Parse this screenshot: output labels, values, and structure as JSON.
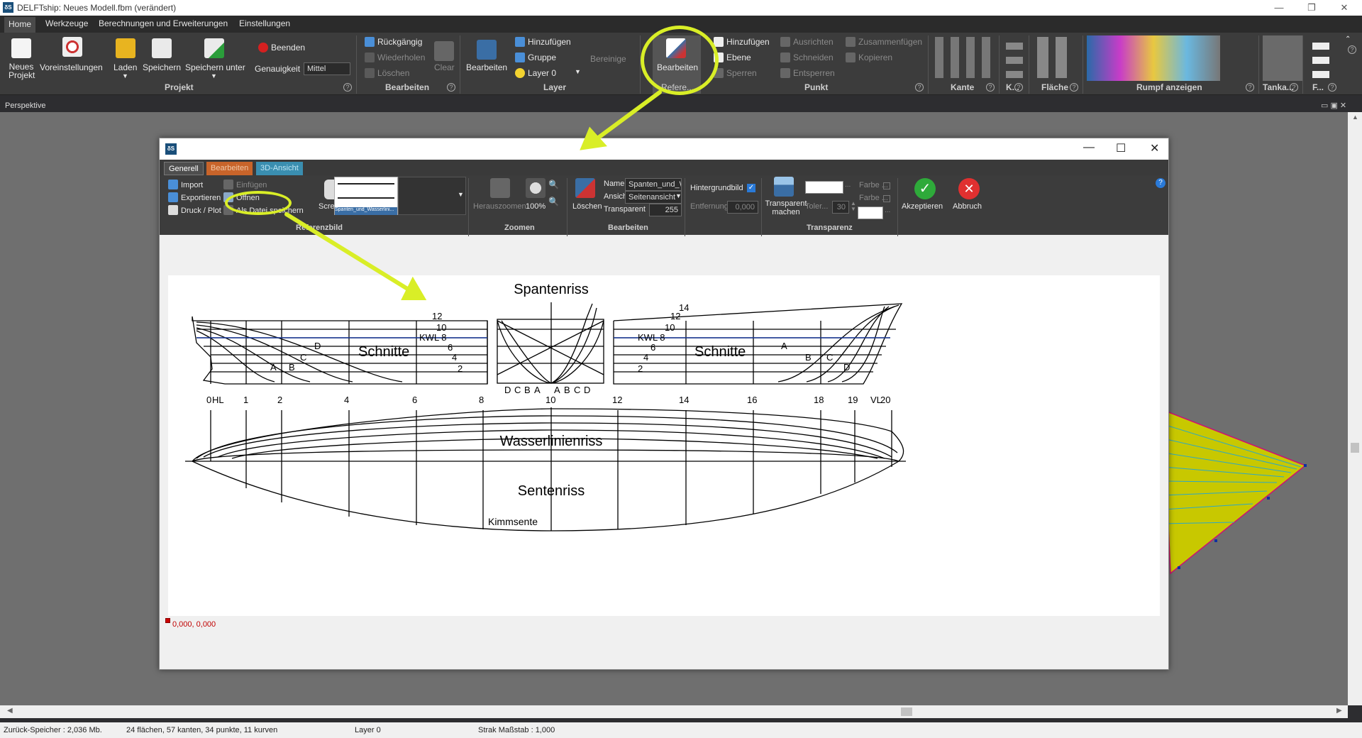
{
  "window": {
    "title": "DELFTship: Neues Modell.fbm (verändert)",
    "icon": "ds"
  },
  "tabs": [
    "Home",
    "Werkzeuge",
    "Berechnungen und Erweiterungen",
    "Einstellungen"
  ],
  "ribbon": {
    "projekt": {
      "group": "Projekt",
      "neues": "Neues Projekt",
      "voreinstellungen": "Voreinstellungen",
      "laden": "Laden",
      "speichern": "Speichern",
      "speichern_unter": "Speichern unter",
      "beenden": "Beenden",
      "genauigkeit_label": "Genauigkeit",
      "genauigkeit_value": "Mittel"
    },
    "bearbeiten": {
      "group": "Bearbeiten",
      "rueckgaengig": "Rückgängig",
      "wiederholen": "Wiederholen",
      "loeschen": "Löschen",
      "clear": "Clear"
    },
    "layer": {
      "group": "Layer",
      "bearbeiten": "Bearbeiten",
      "hinzufuegen": "Hinzufügen",
      "gruppe": "Gruppe",
      "layer0": "Layer 0",
      "bereinigen": "Bereinige"
    },
    "referenz": {
      "group": "Refere...",
      "bearbeiten": "Bearbeiten"
    },
    "ebene": {
      "hinzufuegen": "Hinzufügen",
      "ebene": "Ebene",
      "sperren": "Sperren"
    },
    "punkt": {
      "group": "Punkt",
      "ausrichten": "Ausrichten",
      "schneiden": "Schneiden",
      "entsperren": "Entsperren",
      "zusammenfuegen": "Zusammenfügen",
      "kopieren": "Kopieren"
    },
    "kante": {
      "group": "Kante"
    },
    "k": {
      "group": "K..."
    },
    "flaeche": {
      "group": "Fläche"
    },
    "rumpf": {
      "group": "Rumpf anzeigen"
    },
    "tanka": {
      "group": "Tanka..."
    },
    "f": {
      "group": "F..."
    }
  },
  "viewport": {
    "title": "Perspektive"
  },
  "dialog": {
    "tabs": [
      "Generell",
      "Bearbeiten",
      "3D-Ansicht"
    ],
    "referenzbild": {
      "group": "Referenzbild",
      "import": "Import",
      "exportieren": "Exportieren",
      "druck": "Druck / Plot",
      "einfuegen": "Einfügen",
      "oeffnen": "Öffnen",
      "als_datei": "Als Datei speichern",
      "screenshot": "Screenshot",
      "thumb_caption": "Spanten_und_Wasserlini..."
    },
    "zoomen": {
      "group": "Zoomen",
      "herauszoomen": "Herauszoomen",
      "hundert": "100%"
    },
    "bearbeiten": {
      "group": "Bearbeiten",
      "loeschen": "Löschen",
      "name_label": "Name",
      "name_value": "Spanten_und_Wa",
      "ansicht_label": "Ansicht",
      "ansicht_value": "Seitenansicht",
      "transparent_label": "Transparent",
      "transparent_value": "255"
    },
    "transparenz": {
      "group": "Transparenz",
      "hintergrundbild": "Hintergrundbild",
      "entfernung_label": "Entfernung",
      "entfernung_value": "0,000",
      "transparent_machen": "Transparent machen",
      "toleranz": "Toler...",
      "toleranz_value": "30",
      "farbe1": "Farbe ...",
      "farbe2": "Farbe ..."
    },
    "akzeptieren": "Akzeptieren",
    "abbruch": "Abbruch",
    "coords": "0,000, 0,000"
  },
  "drawing": {
    "spantenriss": "Spantenriss",
    "schnitte": "Schnitte",
    "wasserlinienriss": "Wasserlinienriss",
    "sentenriss": "Sentenriss",
    "kimmsente": "Kimmsente",
    "kwl": "KWL 8",
    "left_wl": [
      "12",
      "10",
      "6",
      "4",
      "2"
    ],
    "right_wl": [
      "14",
      "12",
      "10",
      "6",
      "4",
      "2"
    ],
    "sections": [
      "A",
      "B",
      "C",
      "D"
    ],
    "body_letters": [
      "D",
      "C",
      "B",
      "A",
      "A",
      "B",
      "C",
      "D"
    ],
    "stations": [
      "0",
      "HL",
      "1",
      "2",
      "4",
      "6",
      "8",
      "10",
      "12",
      "14",
      "16",
      "18",
      "19",
      "VL",
      "20"
    ]
  },
  "status": {
    "undo": "Zurück-Speicher : 2,036 Mb.",
    "counts": "24 flächen, 57 kanten, 34 punkte, 11 kurven",
    "layer": "Layer 0",
    "strak": "Strak Maßstab : 1,000"
  },
  "colors": {
    "highlight": "#d9ee27",
    "ribbon": "#3c3c3c",
    "viewport": "#6f6f6f",
    "hull_yellow": "#c8c800",
    "hull_magenta": "#d01070"
  }
}
